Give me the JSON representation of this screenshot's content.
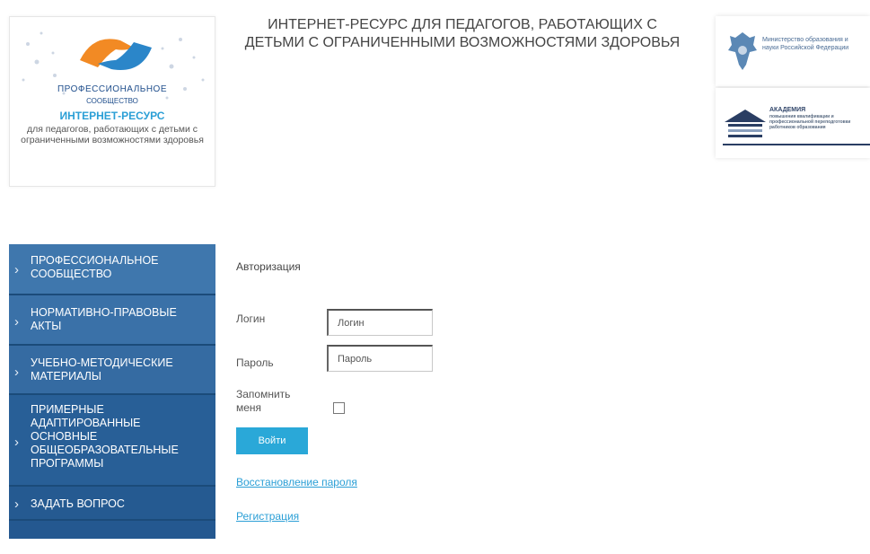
{
  "header": {
    "site_title": "ИНТЕРНЕТ-РЕСУРС ДЛЯ ПЕДАГОГОВ, РАБОТАЮЩИХ С ДЕТЬМИ С ОГРАНИЧЕННЫМИ ВОЗМОЖНОСТЯМИ ЗДОРОВЬЯ",
    "logo": {
      "org_line1": "ПРОФЕССИОНАЛЬНОЕ",
      "org_line2": "СООБЩЕСТВО",
      "resource": "ИНТЕРНЕТ-РЕСУРС",
      "description": "для педагогов, работающих с детьми с ограниченными возможностями здоровья"
    },
    "partners": [
      {
        "name": "Министерство образования и науки Российской Федерации"
      },
      {
        "name": "АКАДЕМИЯ",
        "subtitle": "повышения квалификации и профессиональной переподготовки работников образования"
      }
    ]
  },
  "sidebar": {
    "items": [
      {
        "label": "ПРОФЕССИОНАЛЬНОЕ СООБЩЕСТВО"
      },
      {
        "label": "НОРМАТИВНО-ПРАВОВЫЕ АКТЫ"
      },
      {
        "label": "УЧЕБНО-МЕТОДИЧЕСКИЕ МАТЕРИАЛЫ"
      },
      {
        "label": "ПРИМЕРНЫЕ АДАПТИРОВАННЫЕ ОСНОВНЫЕ ОБЩЕОБРАЗОВАТЕЛЬНЫЕ ПРОГРАММЫ"
      },
      {
        "label": "ЗАДАТЬ ВОПРОС"
      },
      {
        "label": ""
      }
    ]
  },
  "auth": {
    "title": "Авторизация",
    "login_label": "Логин",
    "login_placeholder": "Логин",
    "password_label": "Пароль",
    "password_placeholder": "Пароль",
    "remember_label": "Запомнить меня",
    "remember_checked": false,
    "submit_label": "Войти",
    "restore_link": "Восстановление пароля",
    "register_link": "Регистрация"
  },
  "colors": {
    "nav_bg": "#2f6aa3",
    "nav_border": "#1b4b7a",
    "button_bg": "#2aa8d8",
    "link": "#2b9fd6"
  }
}
